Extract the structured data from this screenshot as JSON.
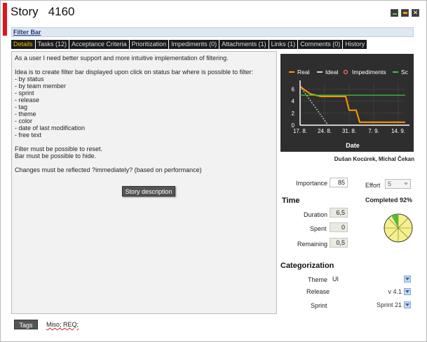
{
  "window": {
    "title_word": "Story",
    "story_number": "4160",
    "filter_bar_label": "Filter Bar",
    "colors": {
      "accent_red": "#e0141c",
      "tab_active": "#f0c000"
    }
  },
  "tabs": [
    {
      "label": "Details",
      "active": true
    },
    {
      "label": "Tasks (12)",
      "active": false
    },
    {
      "label": "Acceptance Criteria",
      "active": false
    },
    {
      "label": "Prioritization",
      "active": false
    },
    {
      "label": "Impediments (0)",
      "active": false
    },
    {
      "label": "Attachments (1)",
      "active": false
    },
    {
      "label": "Links (1)",
      "active": false
    },
    {
      "label": "Comments (0)",
      "active": false
    },
    {
      "label": "History",
      "active": false
    }
  ],
  "description": {
    "lines": [
      "As a user I need better support and more intuitive implementation of filtering.",
      "",
      "Idea is to create filter bar displayed upon click on status bar where is possible to filter:",
      "- by status",
      "- by team member",
      "- sprint",
      "- release",
      "- tag",
      "- theme",
      "- color",
      "- date of last modification",
      "- free text",
      "",
      "Filter must be possible to reset.",
      "Bar must be possible to hide.",
      "",
      "Changes must be reflected ?immediately? (based on performance)"
    ],
    "button_label": "Story description"
  },
  "chart_data": {
    "type": "line",
    "xlabel": "Date",
    "x_ticks": [
      "17. 8.",
      "24. 8.",
      "31. 8.",
      "7. 9.",
      "14. 9."
    ],
    "y_ticks": [
      0,
      2,
      4,
      6
    ],
    "ylim": [
      0,
      7
    ],
    "legend": [
      "Real",
      "Ideal",
      "Impediments",
      "Sc"
    ],
    "series": [
      {
        "name": "Real",
        "color": "#ff9b00",
        "points": [
          [
            0,
            6.5
          ],
          [
            1,
            6.0
          ],
          [
            3,
            5.2
          ],
          [
            6,
            4.8
          ],
          [
            9,
            4.8
          ],
          [
            12,
            4.8
          ],
          [
            13,
            4.8
          ],
          [
            14,
            2.5
          ],
          [
            16,
            2.5
          ],
          [
            17,
            0.5
          ],
          [
            30,
            0.5
          ]
        ]
      },
      {
        "name": "Ideal",
        "color": "#d8d8d8",
        "dashed": true,
        "points": [
          [
            0,
            6.5
          ],
          [
            8,
            0
          ]
        ]
      },
      {
        "name": "Sc",
        "color": "#3ac83a",
        "points": [
          [
            0,
            5.0
          ],
          [
            30,
            5.0
          ]
        ]
      }
    ],
    "grid": true,
    "legend_position": "top"
  },
  "team": {
    "members": "Dušan Kocúrek, Michal Čekan"
  },
  "estimates": {
    "importance_label": "Importance",
    "importance_value": "85",
    "effort_label": "Effort",
    "effort_value": "5",
    "completed_label": "Completed 92%",
    "completed_fraction": 0.92
  },
  "time": {
    "section_title": "Time",
    "duration_label": "Duration",
    "duration_value": "6,5",
    "spent_label": "Spent",
    "spent_value": "0",
    "remaining_label": "Remaining",
    "remaining_value": "0,5"
  },
  "categorization": {
    "section_title": "Categorization",
    "theme_label": "Theme",
    "theme_value": "UI",
    "release_label": "Release",
    "release_value": "v 4.1",
    "sprint_label": "Sprint",
    "sprint_value": "Sprint 21"
  },
  "tags": {
    "button_label": "Tags",
    "values": "Miso; REQ;"
  }
}
